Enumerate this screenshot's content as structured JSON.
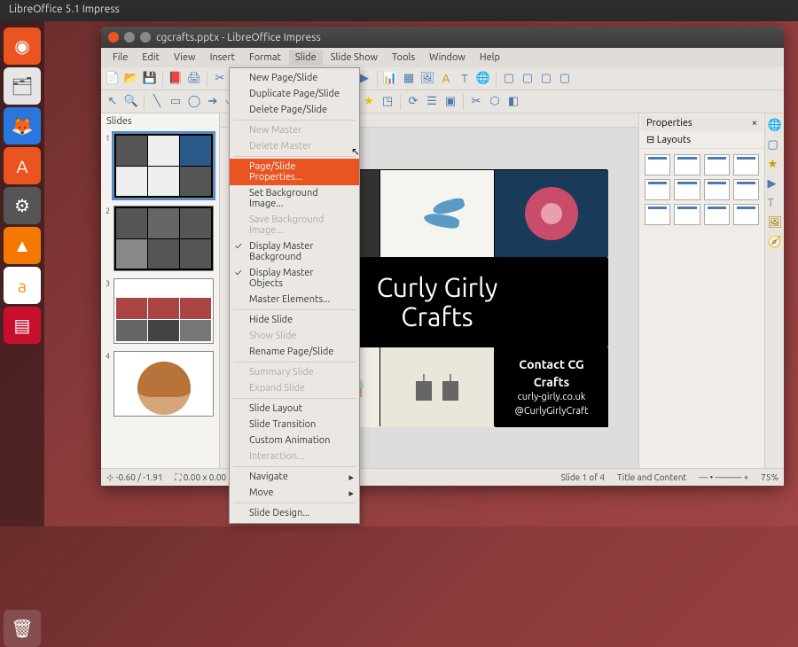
{
  "ubuntu_bar": {
    "title": "LibreOffice 5.1 Impress"
  },
  "launcher": {
    "items": [
      "ubuntu",
      "files",
      "firefox",
      "software",
      "settings",
      "vlc",
      "amazon",
      "impress"
    ],
    "trash": "trash"
  },
  "window": {
    "title": "cgcrafts.pptx - LibreOffice Impress",
    "menus": [
      "File",
      "Edit",
      "View",
      "Insert",
      "Format",
      "Slide",
      "Slide Show",
      "Tools",
      "Window",
      "Help"
    ],
    "open_menu_index": 5
  },
  "slides_panel": {
    "title": "Slides",
    "numbers": [
      "1",
      "2",
      "3",
      "4"
    ]
  },
  "dropdown": {
    "items": [
      {
        "label": "New Page/Slide",
        "type": "item"
      },
      {
        "label": "Duplicate Page/Slide",
        "type": "item"
      },
      {
        "label": "Delete Page/Slide",
        "type": "item"
      },
      {
        "type": "sep"
      },
      {
        "label": "New Master",
        "type": "disabled"
      },
      {
        "label": "Delete Master",
        "type": "disabled"
      },
      {
        "type": "sep"
      },
      {
        "label": "Page/Slide Properties...",
        "type": "highlight"
      },
      {
        "label": "Set Background Image...",
        "type": "item"
      },
      {
        "label": "Save Background Image...",
        "type": "disabled"
      },
      {
        "label": "Display Master Background",
        "type": "check"
      },
      {
        "label": "Display Master Objects",
        "type": "check"
      },
      {
        "label": "Master Elements...",
        "type": "item"
      },
      {
        "type": "sep"
      },
      {
        "label": "Hide Slide",
        "type": "item"
      },
      {
        "label": "Show Slide",
        "type": "disabled"
      },
      {
        "label": "Rename Page/Slide",
        "type": "item"
      },
      {
        "type": "sep"
      },
      {
        "label": "Summary Slide",
        "type": "disabled"
      },
      {
        "label": "Expand Slide",
        "type": "disabled"
      },
      {
        "type": "sep"
      },
      {
        "label": "Slide Layout",
        "type": "item"
      },
      {
        "label": "Slide Transition",
        "type": "item"
      },
      {
        "label": "Custom Animation",
        "type": "item"
      },
      {
        "label": "Interaction...",
        "type": "disabled"
      },
      {
        "type": "sep"
      },
      {
        "label": "Navigate",
        "type": "arrow"
      },
      {
        "label": "Move",
        "type": "arrow"
      },
      {
        "type": "sep"
      },
      {
        "label": "Slide Design...",
        "type": "item"
      }
    ]
  },
  "slide": {
    "title_line1": "Curly Girly",
    "title_line2": "Crafts",
    "contact_title": "Contact CG",
    "contact_title2": "Crafts",
    "contact_url": "curly-girly.co.uk",
    "contact_handle": "@CurlyGirlyCraft"
  },
  "properties": {
    "title": "Properties",
    "section": "Layouts"
  },
  "status": {
    "coord1": "-0.60 / -1.91",
    "coord2": "0.00 x 0.00",
    "slide_info": "Slide 1 of 4",
    "layout_name": "Title and Content",
    "zoom": "75%"
  }
}
